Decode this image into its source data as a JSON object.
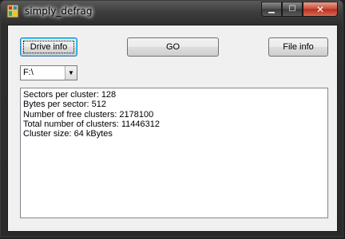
{
  "window": {
    "title": "simply_defrag",
    "controls": {
      "minimize": "▁",
      "maximize": "☐",
      "close": "✕"
    }
  },
  "toolbar": {
    "drive_info_label": "Drive info",
    "go_label": "GO",
    "file_info_label": "File info"
  },
  "drive_select": {
    "value": "F:\\"
  },
  "output": {
    "lines": [
      "Sectors per cluster: 128",
      "Bytes per sector: 512",
      "Number of free clusters: 2178100",
      "Total number of clusters: 11446312",
      "Cluster size: 64 kBytes"
    ]
  },
  "icons": {
    "app": "app-icon",
    "dropdown": "chevron-down-icon"
  }
}
